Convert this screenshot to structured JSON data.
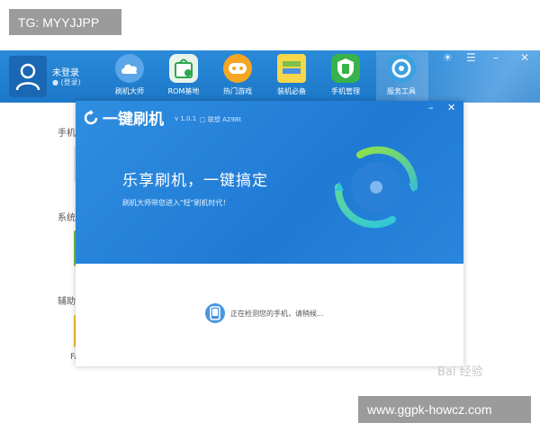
{
  "overlay_labels": {
    "tg": "TG: MYYJJPP",
    "site": "www.ggpk-howcz.com"
  },
  "bg_app": {
    "user": {
      "name": "未登录",
      "sub": "(登录)"
    },
    "nav": [
      {
        "label": "刷机大师",
        "icon": "cloud-icon",
        "color": "#5aa6e8"
      },
      {
        "label": "ROM基地",
        "icon": "shopping-bag-icon",
        "color": "#e8f4ea"
      },
      {
        "label": "热门游戏",
        "icon": "game-icon",
        "color": "#f5a623"
      },
      {
        "label": "装机必备",
        "icon": "layers-icon",
        "color": "#f6d64a"
      },
      {
        "label": "手机管理",
        "icon": "shield-icon",
        "color": "#38b24a"
      },
      {
        "label": "服务工具",
        "icon": "gear-icon",
        "color": "#3aa0e0"
      }
    ],
    "sidebar": [
      "手机",
      "系统",
      "辅助",
      "Fa"
    ]
  },
  "dialog": {
    "title": "一键刷机",
    "version": "v 1.0.1",
    "device": "联想 A298t",
    "headline": "乐享刷机，一键搞定",
    "subline": "刷机大师带您进入\"轻\"刷机时代！",
    "status": "正在检测您的手机，请稍候..."
  },
  "watermark": "Bai 经验",
  "colors": {
    "accent": "#1f7ad4",
    "banner": "#2f8ee0",
    "badge": "#9b9b9b"
  }
}
